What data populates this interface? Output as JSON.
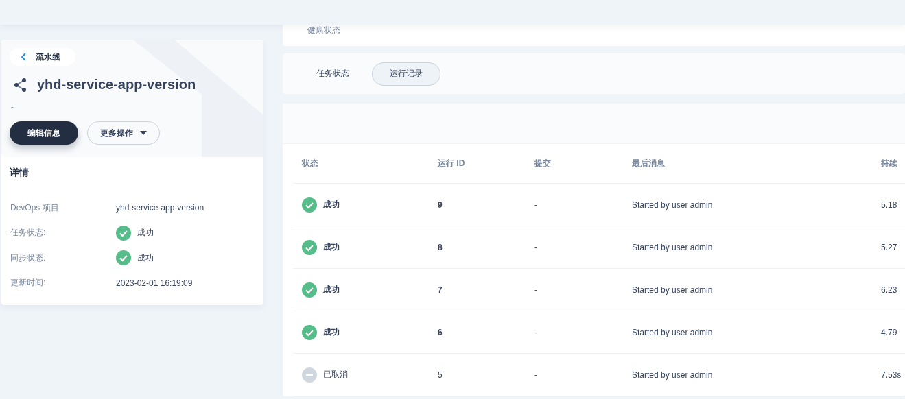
{
  "sidebar": {
    "back": "流水线",
    "title": "yhd-service-app-version",
    "description": "-",
    "buttons": [
      {
        "label": "编辑信息",
        "kind": "primary"
      },
      {
        "label": "更多操作",
        "kind": "dropdown"
      }
    ],
    "details_title": "详情",
    "details": [
      {
        "label": "DevOps 项目:",
        "value": "yhd-service-app-version"
      },
      {
        "label": "任务状态:",
        "value": "成功",
        "kind": "success"
      },
      {
        "label": "同步状态:",
        "value": "成功",
        "kind": "success"
      },
      {
        "label": "更新时间:",
        "value": "2023-02-01 16:19:09"
      }
    ]
  },
  "health_label": "健康状态",
  "tabs": [
    {
      "label": "任务状态",
      "selected": false
    },
    {
      "label": "运行记录",
      "selected": true
    }
  ],
  "table": {
    "columns": [
      "状态",
      "运行 ID",
      "提交",
      "最后消息",
      "持续"
    ],
    "rows": [
      {
        "kind": "success",
        "status_text": "成功",
        "run_id": "9",
        "commit": "-",
        "message": "Started by user admin",
        "duration": "5.18"
      },
      {
        "kind": "success",
        "status_text": "成功",
        "run_id": "8",
        "commit": "-",
        "message": "Started by user admin",
        "duration": "5.27"
      },
      {
        "kind": "success",
        "status_text": "成功",
        "run_id": "7",
        "commit": "-",
        "message": "Started by user admin",
        "duration": "6.23"
      },
      {
        "kind": "success",
        "status_text": "成功",
        "run_id": "6",
        "commit": "-",
        "message": "Started by user admin",
        "duration": "4.79"
      },
      {
        "kind": "cancelled",
        "status_text": "已取消",
        "run_id": "5",
        "commit": "-",
        "message": "Started by user admin",
        "duration": "7.53s"
      }
    ]
  }
}
